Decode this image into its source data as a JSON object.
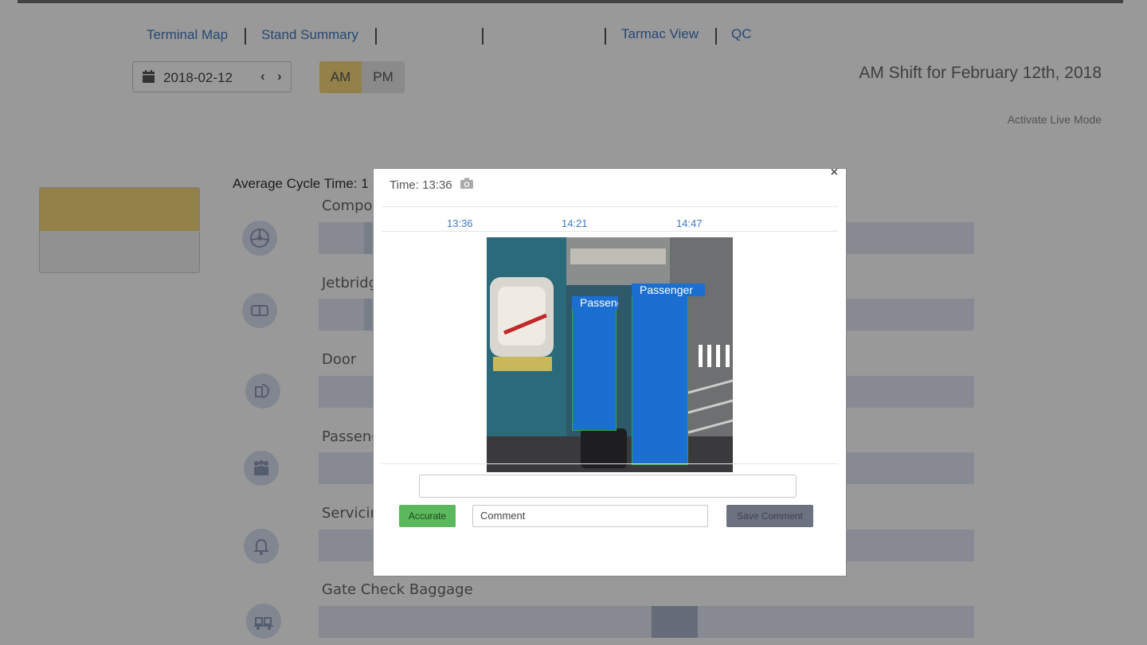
{
  "nav": {
    "links": [
      "Terminal Map",
      "Stand Summary",
      "Tarmac View",
      "QC"
    ]
  },
  "date_picker": {
    "value": "2018-02-12",
    "icon": "calendar-icon",
    "prev_icon": "chevron-left-icon",
    "next_icon": "chevron-right-icon"
  },
  "shift_toggle": {
    "am": "AM",
    "pm": "PM",
    "selected": "AM",
    "active_color": "#f5d77a"
  },
  "header": {
    "title": "AM Shift for February 12th, 2018",
    "live_mode": "Activate Live Mode"
  },
  "avg_cycle": {
    "label": "Average Cycle Time: 1"
  },
  "rows": [
    {
      "label": "Compos",
      "icon": "steering-wheel-icon"
    },
    {
      "label": "Jetbridg",
      "icon": "jetbridge-icon"
    },
    {
      "label": "Door",
      "icon": "door-icon"
    },
    {
      "label": "Passeng",
      "icon": "passengers-icon"
    },
    {
      "label": "Servicin",
      "icon": "bell-icon"
    },
    {
      "label": "Gate Check Baggage",
      "icon": "baggage-cart-icon"
    }
  ],
  "modal": {
    "time_label": "Time: 13:36",
    "close": "×",
    "timestamps": [
      "13:36",
      "14:21",
      "14:47"
    ],
    "detections": [
      {
        "label": "Passenge"
      },
      {
        "label": "Passenger"
      }
    ],
    "accurate_button": "Accurate",
    "comment_value": "Comment",
    "save_button": "Save Comment",
    "colors": {
      "accurate": "#5cb85c",
      "save": "#6c7280",
      "detection": "#1a6fd1",
      "link": "#3f78c3"
    }
  }
}
